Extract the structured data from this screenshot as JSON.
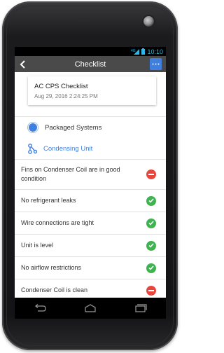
{
  "status_bar": {
    "time": "10:10",
    "signal_label": "4G"
  },
  "app_bar": {
    "title": "Checklist",
    "more_label": "···"
  },
  "card": {
    "title": "AC CPS Checklist",
    "timestamp": "Aug 29, 2016 2:24:25 PM"
  },
  "system_type": {
    "label": "Packaged Systems"
  },
  "unit": {
    "label": "Condensing Unit"
  },
  "items": [
    {
      "label": "Fins on Condenser Coil are in good condition",
      "status": "fail"
    },
    {
      "label": "No refrigerant leaks",
      "status": "pass"
    },
    {
      "label": "Wire connections are tight",
      "status": "pass"
    },
    {
      "label": "Unit is level",
      "status": "pass"
    },
    {
      "label": "No airflow restrictions",
      "status": "pass"
    },
    {
      "label": "Condenser Coil is clean",
      "status": "fail"
    }
  ],
  "colors": {
    "accent": "#3f7fe0",
    "pass": "#3fb34f",
    "fail": "#e8453c",
    "app_bar": "#4a4a4a"
  },
  "icons": {
    "back": "chevron-left-icon",
    "more": "more-dots-icon",
    "pass": "check-circle-icon",
    "fail": "minus-circle-icon",
    "unit": "branch-icon",
    "nav": [
      "back-nav-icon",
      "home-nav-icon",
      "recents-nav-icon"
    ]
  }
}
